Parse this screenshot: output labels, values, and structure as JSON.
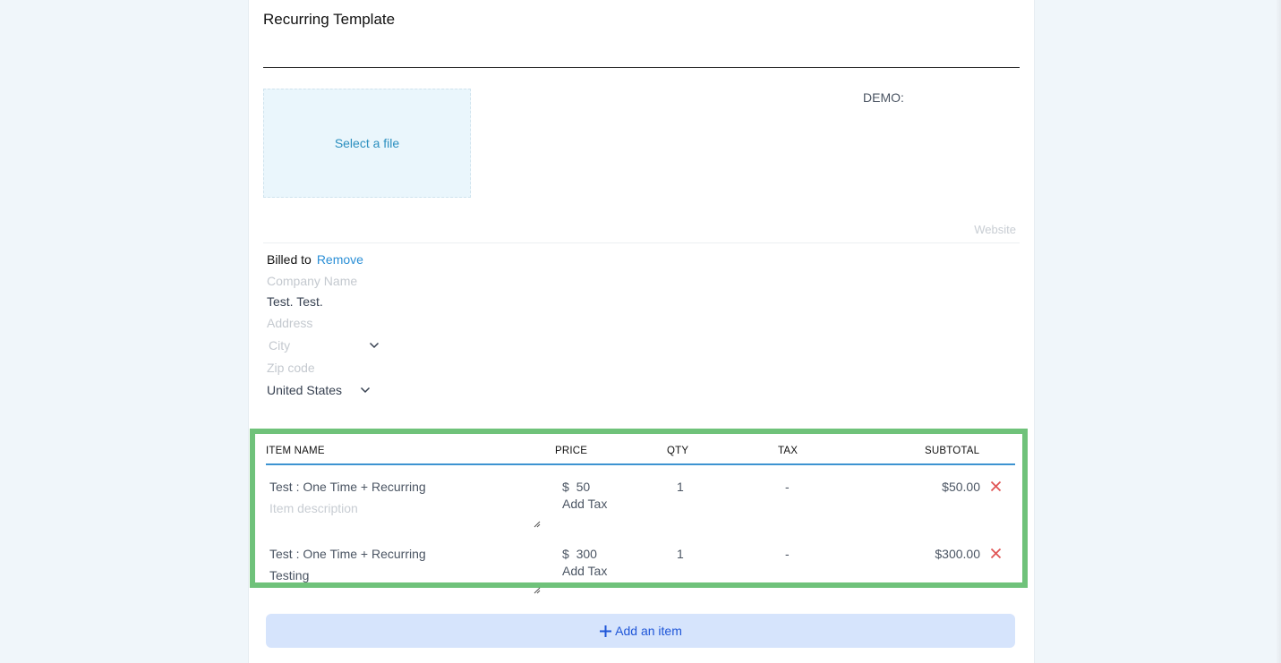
{
  "invoice": {
    "title": "Recurring Template",
    "logo_upload_label": "Select a file",
    "company_name_label": "DEMO:",
    "website_placeholder": "Website"
  },
  "billed_to": {
    "label": "Billed to",
    "remove_label": "Remove",
    "company_placeholder": "Company Name",
    "name_value": "Test. Test.",
    "address_placeholder": "Address",
    "city_placeholder": "City",
    "zip_placeholder": "Zip code",
    "country_value": "United States"
  },
  "items": {
    "headers": {
      "item_name": "ITEM NAME",
      "price": "PRICE",
      "qty": "QTY",
      "tax": "TAX",
      "subtotal": "SUBTOTAL"
    },
    "rows": [
      {
        "name": "Test : One Time + Recurring",
        "description": "",
        "description_placeholder": "Item description",
        "currency": "$",
        "price": "50",
        "add_tax": "Add Tax",
        "qty": "1",
        "tax": "-",
        "subtotal": "$50.00"
      },
      {
        "name": "Test : One Time + Recurring",
        "description": "Testing",
        "description_placeholder": "",
        "currency": "$",
        "price": "300",
        "add_tax": "Add Tax",
        "qty": "1",
        "tax": "-",
        "subtotal": "$300.00"
      }
    ],
    "add_item_label": "Add an item",
    "highlight_color": "#6fc27a",
    "accent_color": "#3d93d1"
  },
  "icons": {
    "chevron": "chevron-down-icon",
    "delete": "close-icon",
    "plus": "plus-icon",
    "resize": "resize-handle-icon"
  }
}
